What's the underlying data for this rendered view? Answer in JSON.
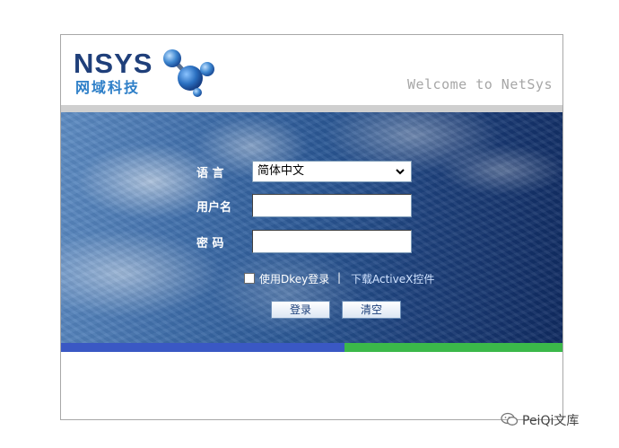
{
  "header": {
    "logo_text": "NSYS",
    "logo_subtitle": "网域科技",
    "welcome": "Welcome to NetSys"
  },
  "login": {
    "language_label": "语 言",
    "language_value": "简体中文",
    "username_label": "用户名",
    "username_value": "",
    "password_label": "密 码",
    "password_value": "",
    "dkey_checkbox_label": "使用Dkey登录",
    "separator": "|",
    "activex_link": "下载ActiveX控件",
    "login_button": "登录",
    "clear_button": "清空"
  },
  "watermark": {
    "text": "PeiQi文库"
  },
  "colors": {
    "brand_blue": "#1f3f7a",
    "brand_light_blue": "#2e7fc8",
    "bar_blue": "#3a58c4",
    "bar_green": "#3bb84a"
  }
}
